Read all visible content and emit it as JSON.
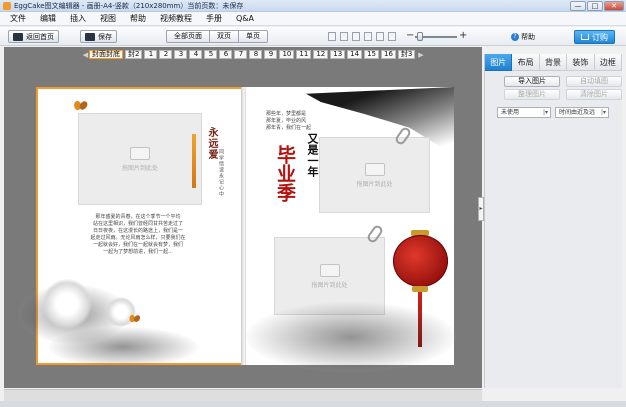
{
  "window": {
    "title": "EggCake图文编辑器 - 画册-A4-竖款（210x280mm）当前页数：未保存",
    "controls": [
      "—",
      "□",
      "✕"
    ]
  },
  "menu": [
    "文件",
    "编辑",
    "插入",
    "视图",
    "帮助",
    "视频教程",
    "手册",
    "Q&A"
  ],
  "toolbar": {
    "back_label": "返回首页",
    "save_label": "保存",
    "view_modes": [
      "全部页面",
      "双页",
      "单页"
    ],
    "help_label": "帮助",
    "order_label": "订购",
    "zoom_minus": "−",
    "zoom_plus": "+",
    "zoom_level": 0.12
  },
  "page_strip": {
    "left_arrow": "◀",
    "right_arrow": "▶",
    "pages": [
      "封面封底",
      "封2",
      "1",
      "2",
      "3",
      "4",
      "5",
      "6",
      "7",
      "8",
      "9",
      "10",
      "11",
      "12",
      "13",
      "14",
      "15",
      "16",
      "封3"
    ]
  },
  "canvas": {
    "photo_placeholder": "拖图片到此处",
    "left_vertical": "永远爱",
    "left_small_vertical": "同学情谊永记心中",
    "left_paragraph": "那年盛夏的青春，在这个季节一个平均\n站在这里相识，我们曾经同甘共苦走过了\n日日夜夜，在这漫长的路途上，我们是一\n起走过风雨。无论风雨怎么样，只要我们在\n一起就会好，我们在一起就会有梦，我们\n一起为了梦想前进，我们一起...",
    "right_paragraph": "那些年，梦里都是\n那年夏，毕业的风\n那年青，我们在一起",
    "right_black_title": "又是一年",
    "right_red_title": "毕业季"
  },
  "right_panel": {
    "tabs": [
      "图片",
      "布局",
      "背景",
      "装饰",
      "边框"
    ],
    "buttons": [
      "导入图片",
      "自动填图",
      "整理图片",
      "清除图片"
    ],
    "filter_select": "未使用",
    "sort_select": "时间由近及远"
  },
  "colors": {
    "accent": "#1f86d6",
    "selected_border": "#f29b2b",
    "title_red": "#b3120e"
  }
}
